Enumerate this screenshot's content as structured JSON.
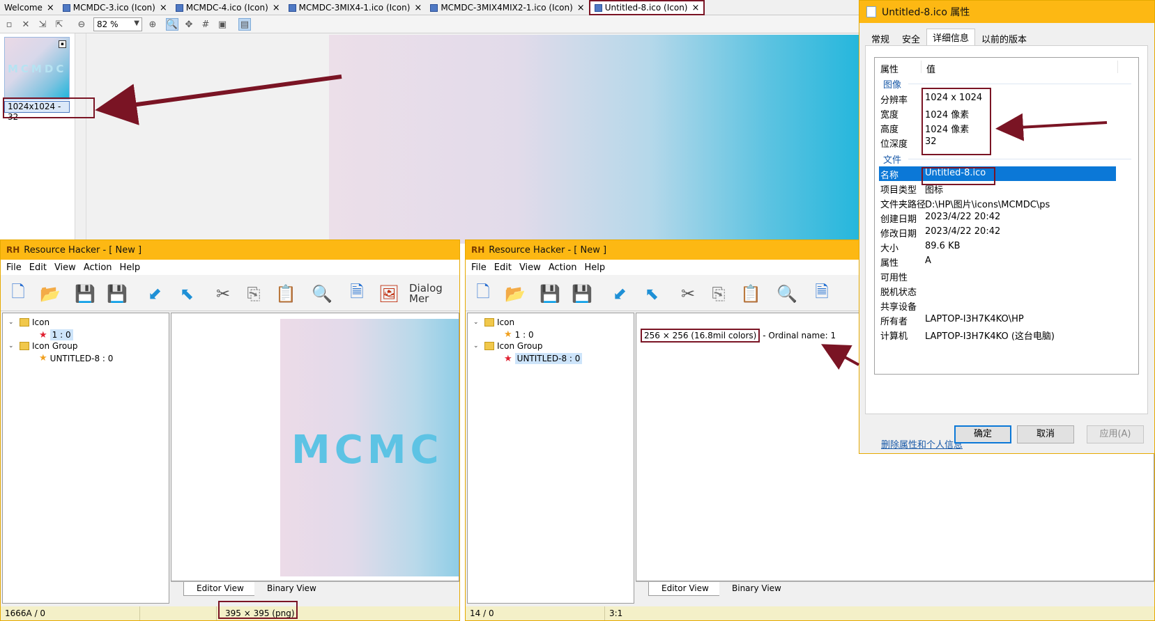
{
  "editor": {
    "tabs": [
      {
        "label": "Welcome"
      },
      {
        "label": "MCMDC-3.ico (Icon)"
      },
      {
        "label": "MCMDC-4.ico (Icon)"
      },
      {
        "label": "MCMDC-3MIX4-1.ico (Icon)"
      },
      {
        "label": "MCMDC-3MIX4MIX2-1.ico (Icon)"
      },
      {
        "label": "Untitled-8.ico (Icon)"
      }
    ],
    "close_glyph": "×",
    "zoom": "82 %",
    "thumbnail_text": "MCMDC",
    "thumbnail_label": "1024x1024 - 32"
  },
  "rh_left": {
    "title": "Resource Hacker - [ New ]",
    "logo": "RH",
    "menu": [
      "File",
      "Edit",
      "View",
      "Action",
      "Help"
    ],
    "toolbar_text": "Dialog Mer",
    "tree": {
      "icon_label": "Icon",
      "icon_child": "1 : 0",
      "group_label": "Icon Group",
      "group_child": "UNTITLED-8 : 0"
    },
    "preview_text": "MCMC",
    "view_tabs": [
      "Editor View",
      "Binary View"
    ],
    "status": [
      "1666A / 0",
      "",
      "395 × 395 (png)"
    ]
  },
  "rh_right": {
    "title": "Resource Hacker - [ New ]",
    "logo": "RH",
    "menu": [
      "File",
      "Edit",
      "View",
      "Action",
      "Help"
    ],
    "tree": {
      "icon_label": "Icon",
      "icon_child": "1 : 0",
      "group_label": "Icon Group",
      "group_child": "UNTITLED-8 : 0"
    },
    "info_size": "256 × 256 (16.8mil colors)",
    "info_rest": " - Ordinal name: 1",
    "view_tabs": [
      "Editor View",
      "Binary View"
    ],
    "status": [
      "14 / 0",
      "3:1"
    ]
  },
  "properties": {
    "title": "Untitled-8.ico 属性",
    "tabs": [
      "常规",
      "安全",
      "详细信息",
      "以前的版本"
    ],
    "header_key": "属性",
    "header_value": "值",
    "group_image": "图像",
    "image_rows": [
      {
        "k": "分辨率",
        "v": "1024 x 1024"
      },
      {
        "k": "宽度",
        "v": "1024 像素"
      },
      {
        "k": "高度",
        "v": "1024 像素"
      },
      {
        "k": "位深度",
        "v": "32"
      }
    ],
    "group_file": "文件",
    "file_rows": [
      {
        "k": "名称",
        "v": "Untitled-8.ico"
      },
      {
        "k": "项目类型",
        "v": "图标"
      },
      {
        "k": "文件夹路径",
        "v": "D:\\HP\\图片\\icons\\MCMDC\\ps"
      },
      {
        "k": "创建日期",
        "v": "2023/4/22 20:42"
      },
      {
        "k": "修改日期",
        "v": "2023/4/22 20:42"
      },
      {
        "k": "大小",
        "v": "89.6 KB"
      },
      {
        "k": "属性",
        "v": "A"
      },
      {
        "k": "可用性",
        "v": ""
      },
      {
        "k": "脱机状态",
        "v": ""
      },
      {
        "k": "共享设备",
        "v": ""
      },
      {
        "k": "所有者",
        "v": "LAPTOP-I3H7K4KO\\HP"
      },
      {
        "k": "计算机",
        "v": "LAPTOP-I3H7K4KO (这台电脑)"
      }
    ],
    "link": "删除属性和个人信息",
    "buttons": {
      "ok": "确定",
      "cancel": "取消",
      "apply": "应用(A)"
    }
  },
  "colors": {
    "title_bar": "#fdb813",
    "annotation": "#7a1424",
    "selection": "#0b78d7"
  }
}
